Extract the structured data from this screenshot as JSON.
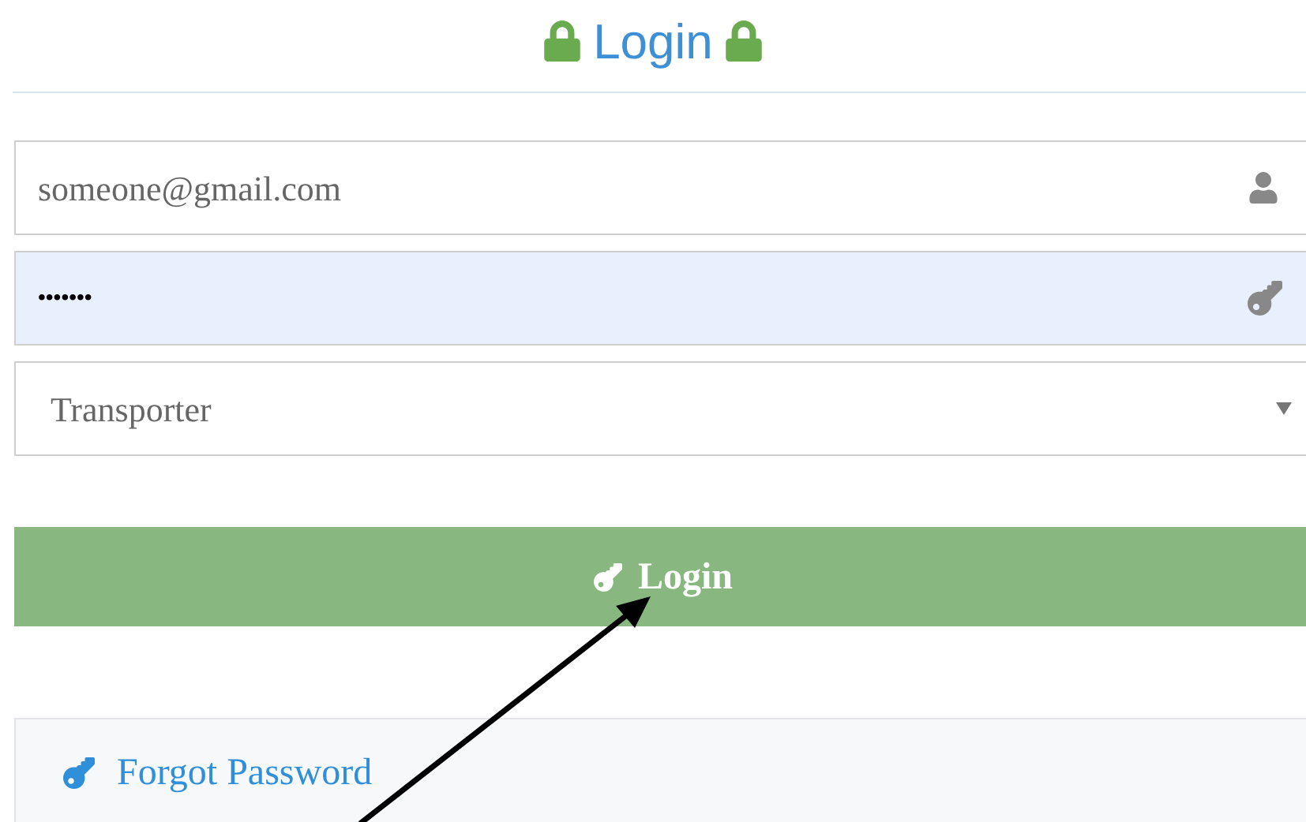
{
  "heading": {
    "title": "Login"
  },
  "form": {
    "email": {
      "value": "someone@gmail.com"
    },
    "password": {
      "value": "•••••••",
      "autofilled": true
    },
    "role": {
      "value": "Transporter"
    }
  },
  "login_button": {
    "label": "Login"
  },
  "forgot_link": {
    "label": "Forgot Password"
  }
}
